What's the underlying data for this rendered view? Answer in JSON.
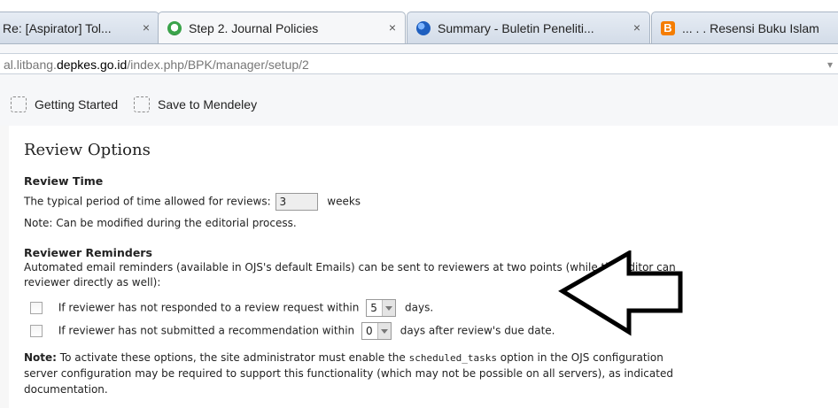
{
  "tabs": [
    {
      "title": "Re: [Aspirator] Tol...",
      "icon": "none",
      "active": false
    },
    {
      "title": "Step 2. Journal Policies",
      "icon": "journal-favicon-icon",
      "active": true
    },
    {
      "title": "Summary - Buletin Peneliti...",
      "icon": "summary-favicon-icon",
      "active": false
    },
    {
      "title": "... . . Resensi Buku Islam",
      "icon": "blogger-icon",
      "active": false
    }
  ],
  "close_glyph": "×",
  "address": {
    "prefix": "al.litbang.",
    "host": "depkes.go.id",
    "path": "/index.php/BPK/manager/setup/2",
    "end_glyph": "▾"
  },
  "bookmarks": [
    {
      "label": "Getting Started"
    },
    {
      "label": "Save to Mendeley"
    }
  ],
  "page": {
    "heading": "Review Options",
    "review_time": {
      "title": "Review Time",
      "prompt": "The typical period of time allowed for reviews:",
      "value": "3",
      "unit": "weeks",
      "note": "Note: Can be modified during the editorial process."
    },
    "reminders": {
      "title": "Reviewer Reminders",
      "desc_line1": "Automated email reminders (available in OJS's default Emails) can be sent to reviewers at two points (while the editor can",
      "desc_line2": "reviewer directly as well):",
      "option1_prefix": "If reviewer has not responded to a review request within",
      "option1_value": "5",
      "option1_suffix": "days.",
      "option1_checked": false,
      "option2_prefix": "If reviewer has not submitted a recommendation within",
      "option2_value": "0",
      "option2_suffix": "days after review's due date.",
      "option2_checked": false,
      "note_label": "Note:",
      "note_text1": "To activate these options, the site administrator must enable the",
      "note_code": "scheduled_tasks",
      "note_text2": "option in the OJS configuration",
      "note_line2": "server configuration may be required to support this functionality (which may not be possible on all servers), as indicated",
      "note_line3": "documentation."
    }
  },
  "colors": {
    "tab_border": "#a9b5c4",
    "chrome_bg": "#f6f7f9",
    "annotation_arrow": "#000000"
  }
}
